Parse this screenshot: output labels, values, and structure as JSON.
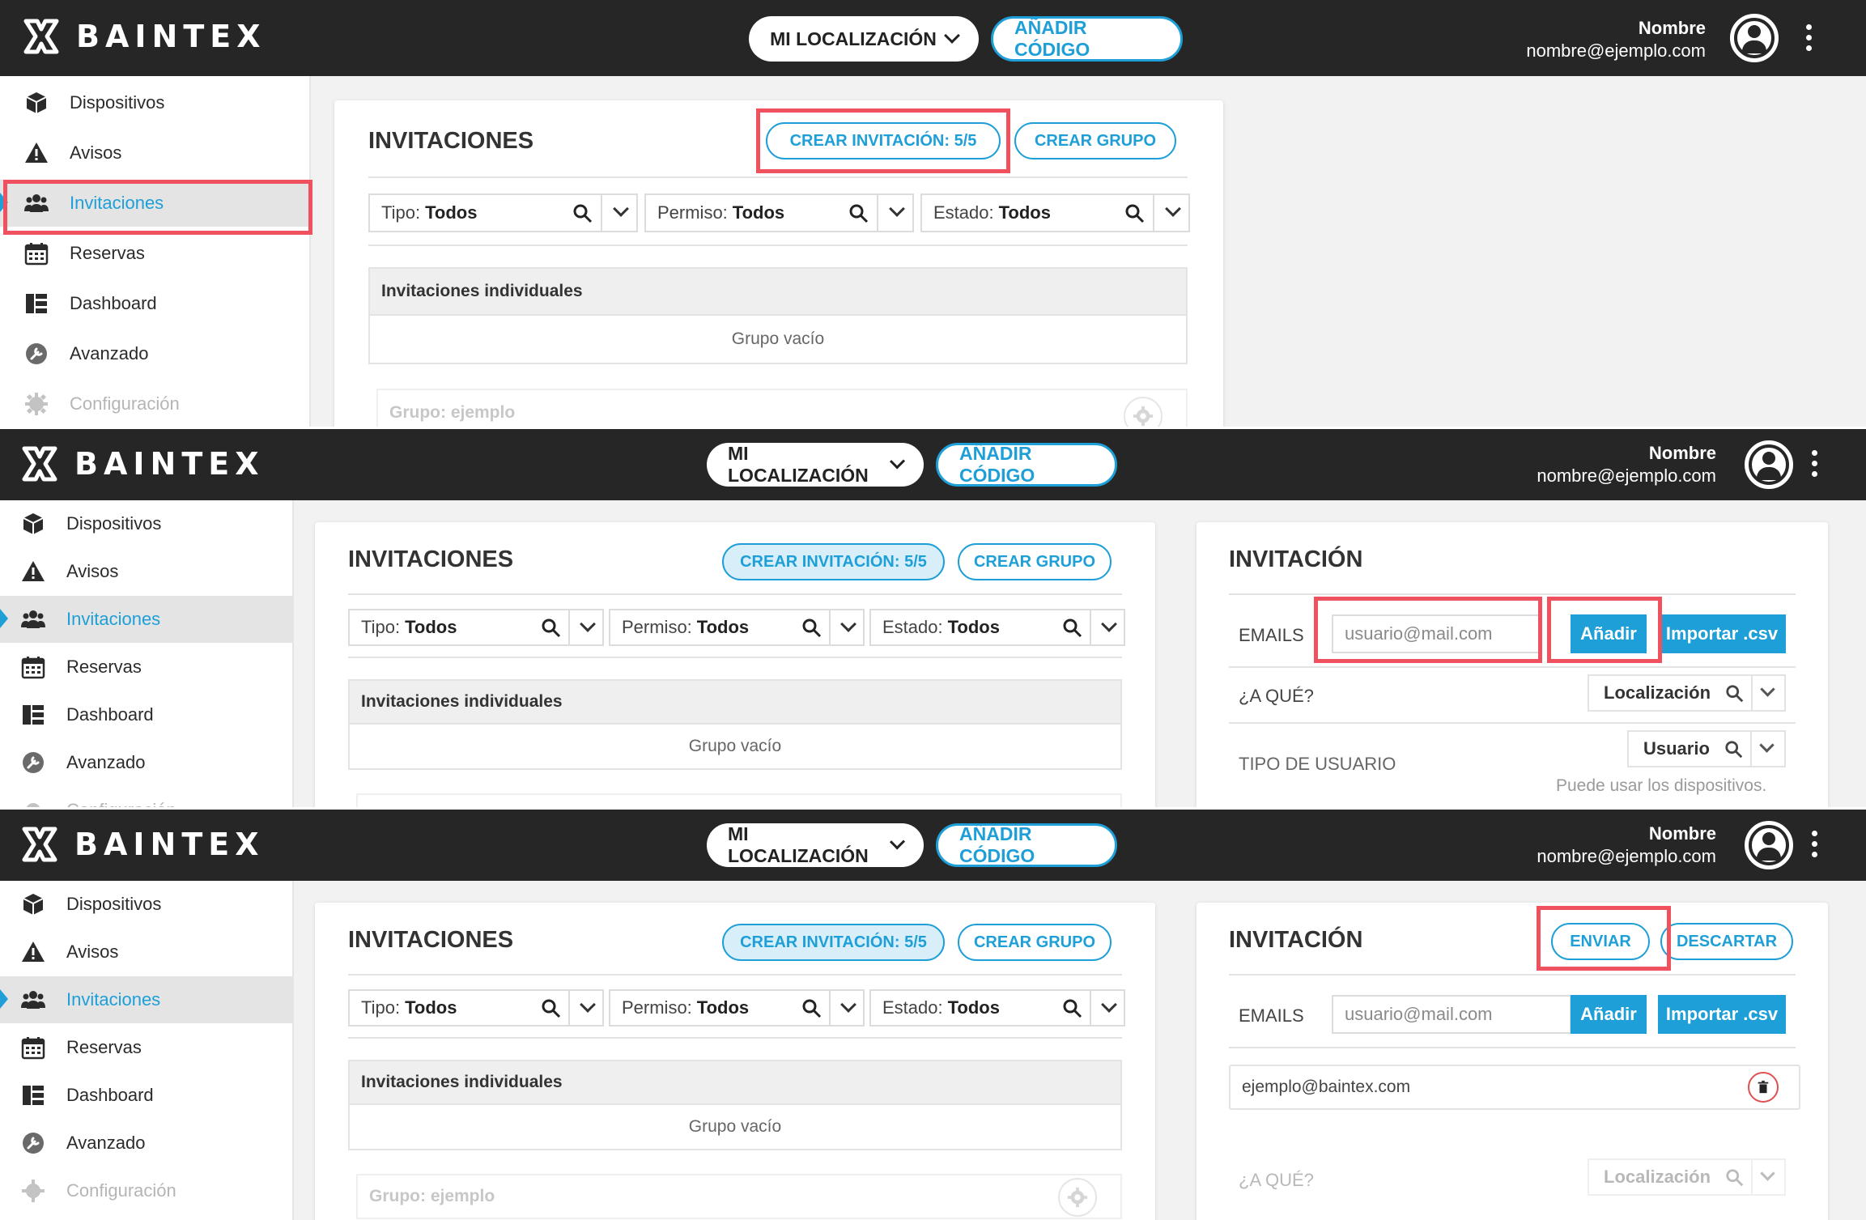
{
  "brand": "BAINTEX",
  "header": {
    "location_label": "MI LOCALIZACIÓN",
    "add_code_label": "AÑADIR CÓDIGO",
    "user_name": "Nombre",
    "user_email": "nombre@ejemplo.com"
  },
  "sidebar": {
    "items": [
      {
        "label": "Dispositivos",
        "icon": "cube-icon"
      },
      {
        "label": "Avisos",
        "icon": "warning-icon"
      },
      {
        "label": "Invitaciones",
        "icon": "users-icon"
      },
      {
        "label": "Reservas",
        "icon": "calendar-icon"
      },
      {
        "label": "Dashboard",
        "icon": "dashboard-icon"
      },
      {
        "label": "Avanzado",
        "icon": "wrench-icon"
      },
      {
        "label": "Configuración",
        "icon": "gear-icon"
      }
    ],
    "active": "Invitaciones"
  },
  "invitations": {
    "title": "INVITACIONES",
    "create_invitation": "CREAR INVITACIÓN: 5/5",
    "create_group": "CREAR GRUPO",
    "filters": [
      {
        "label": "Tipo:",
        "value": "Todos"
      },
      {
        "label": "Permiso:",
        "value": "Todos"
      },
      {
        "label": "Estado:",
        "value": "Todos"
      }
    ],
    "individual_group": "Invitaciones individuales",
    "empty_group": "Grupo vacío",
    "example_group": "Grupo: ejemplo"
  },
  "invitation_form": {
    "title": "INVITACIÓN",
    "send": "ENVIAR",
    "discard": "DESCARTAR",
    "emails_label": "EMAILS",
    "email_placeholder": "usuario@mail.com",
    "add": "Añadir",
    "import_csv": "Importar .csv",
    "what_label": "¿A QUÉ?",
    "what_value": "Localización",
    "user_type_label": "TIPO DE USUARIO",
    "user_type_value": "Usuario",
    "user_type_hint": "Puede usar los dispositivos.",
    "added_email": "ejemplo@baintex.com"
  },
  "colors": {
    "accent": "#1e9fd8",
    "highlight": "#f0515f",
    "topbar": "#262626"
  }
}
